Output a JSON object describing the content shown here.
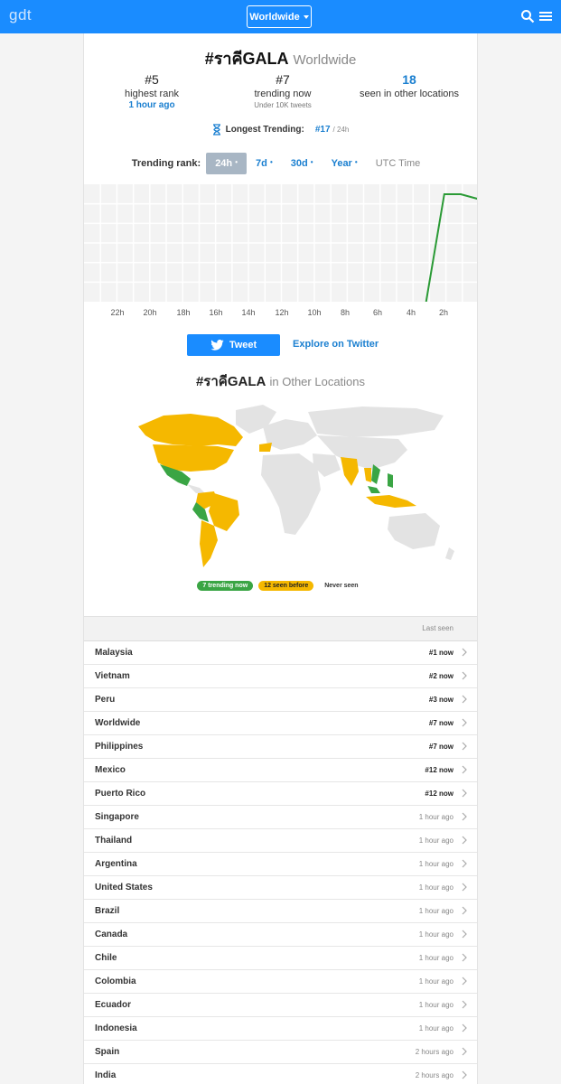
{
  "header": {
    "logo": "gdt",
    "location_button": "Worldwide",
    "icons": [
      "search-icon",
      "menu-icon"
    ]
  },
  "hashtag": {
    "title": "#ราคีGALA",
    "scope": "Worldwide"
  },
  "stats": {
    "highest_rank": {
      "value": "#5",
      "label": "highest rank",
      "sub": "1 hour ago"
    },
    "trending_now": {
      "value": "#7",
      "label": "trending now",
      "sub": "Under 10K tweets"
    },
    "other_locations": {
      "value": "18",
      "label": "seen in other locations"
    }
  },
  "longest": {
    "label": "Longest Trending:",
    "value": "#17",
    "unit": "/ 24h",
    "icon": "hourglass-icon"
  },
  "rank_tabs": {
    "label": "Trending rank:",
    "tabs": [
      "24h",
      "7d",
      "30d",
      "Year"
    ],
    "utc": "UTC Time",
    "active": "24h"
  },
  "chart_data": {
    "type": "line",
    "x_tick_labels": [
      "22h",
      "20h",
      "18h",
      "16h",
      "14h",
      "12h",
      "10h",
      "8h",
      "6h",
      "4h",
      "2h"
    ],
    "x_hours_ago": [
      24,
      3.2,
      2.1,
      1.1,
      0
    ],
    "y_rank": [
      null,
      50,
      7,
      7,
      9
    ],
    "color": "#2a9a35",
    "grid": true,
    "y_inverted": true
  },
  "actions": {
    "tweet": "Tweet",
    "explore": "Explore on Twitter"
  },
  "other_locations_title": {
    "tag": "#ราคีGALA",
    "suffix": "in Other Locations"
  },
  "legend": {
    "trending": "7 trending now",
    "seen": "12 seen before",
    "never": "Never seen"
  },
  "colors": {
    "trending": "#3aa544",
    "seen": "#f5b800",
    "never": "#e3e3e3",
    "brand": "#1a8cff"
  },
  "list": {
    "header": "Last seen",
    "rows": [
      {
        "name": "Malaysia",
        "value": "#1 now",
        "now": true
      },
      {
        "name": "Vietnam",
        "value": "#2 now",
        "now": true
      },
      {
        "name": "Peru",
        "value": "#3 now",
        "now": true
      },
      {
        "name": "Worldwide",
        "value": "#7 now",
        "now": true
      },
      {
        "name": "Philippines",
        "value": "#7 now",
        "now": true
      },
      {
        "name": "Mexico",
        "value": "#12 now",
        "now": true
      },
      {
        "name": "Puerto Rico",
        "value": "#12 now",
        "now": true
      },
      {
        "name": "Singapore",
        "value": "1 hour ago",
        "now": false
      },
      {
        "name": "Thailand",
        "value": "1 hour ago",
        "now": false
      },
      {
        "name": "Argentina",
        "value": "1 hour ago",
        "now": false
      },
      {
        "name": "United States",
        "value": "1 hour ago",
        "now": false
      },
      {
        "name": "Brazil",
        "value": "1 hour ago",
        "now": false
      },
      {
        "name": "Canada",
        "value": "1 hour ago",
        "now": false
      },
      {
        "name": "Chile",
        "value": "1 hour ago",
        "now": false
      },
      {
        "name": "Colombia",
        "value": "1 hour ago",
        "now": false
      },
      {
        "name": "Ecuador",
        "value": "1 hour ago",
        "now": false
      },
      {
        "name": "Indonesia",
        "value": "1 hour ago",
        "now": false
      },
      {
        "name": "Spain",
        "value": "2 hours ago",
        "now": false
      },
      {
        "name": "India",
        "value": "2 hours ago",
        "now": false
      }
    ]
  }
}
